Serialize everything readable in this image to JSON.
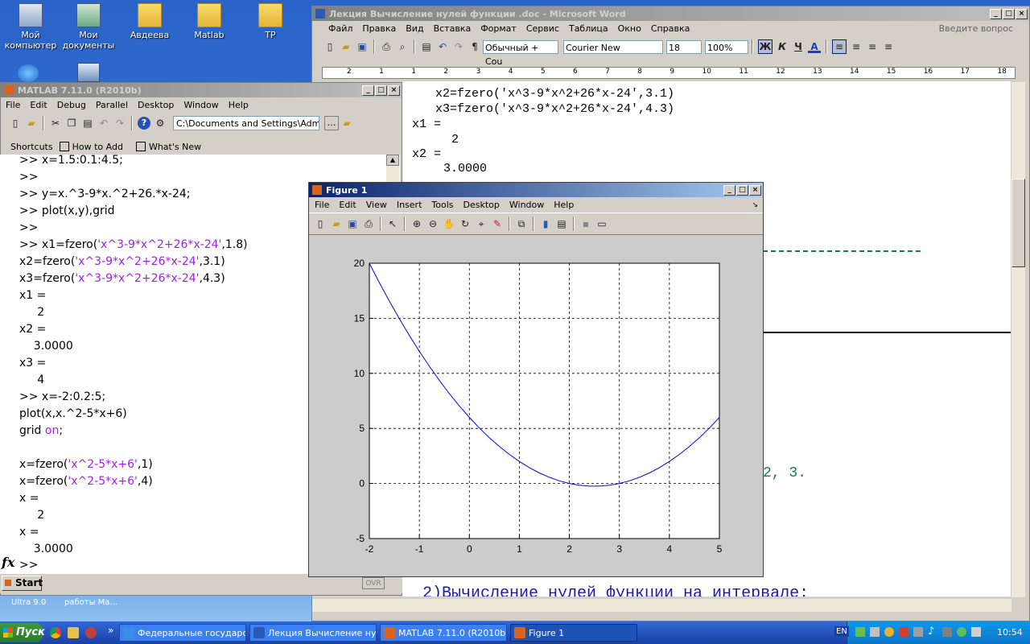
{
  "desktop": {
    "icons": [
      {
        "label": "Мой\nкомпьютер"
      },
      {
        "label": "Мои\nдокументы"
      },
      {
        "label": "Авдеева"
      },
      {
        "label": "Matlab"
      },
      {
        "label": "TP"
      }
    ],
    "behind_text": {
      "line1": "Ultra 9.0",
      "line2": "работы Ма..."
    }
  },
  "matlab": {
    "title": "MATLAB  7.11.0 (R2010b)",
    "menu": [
      "File",
      "Edit",
      "Debug",
      "Parallel",
      "Desktop",
      "Window",
      "Help"
    ],
    "current_folder": "C:\\Documents and Settings\\Admi",
    "shortcuts": {
      "label": "Shortcuts",
      "how_to_add": "How to Add",
      "whats_new": "What's New"
    },
    "fx_symbol": "fx",
    "prompt": ">>",
    "start_button": "Start",
    "ovr": "OVR",
    "command_lines": [
      {
        "plain": ">> x=1.5:0.1:4.5;"
      },
      {
        "plain": ">>"
      },
      {
        "plain": ">> y=x.^3-9*x.^2+26.*x-24;"
      },
      {
        "plain": ">> plot(x,y),grid"
      },
      {
        "plain": ">>"
      },
      {
        "pre": ">> x1=fzero(",
        "str": "'x^3-9*x^2+26*x-24'",
        "post": ",1.8)"
      },
      {
        "pre": "x2=fzero(",
        "str": "'x^3-9*x^2+26*x-24'",
        "post": ",3.1)"
      },
      {
        "pre": "x3=fzero(",
        "str": "'x^3-9*x^2+26*x-24'",
        "post": ",4.3)"
      },
      {
        "plain": "x1 ="
      },
      {
        "plain": "     2"
      },
      {
        "plain": "x2 ="
      },
      {
        "plain": "    3.0000"
      },
      {
        "plain": "x3 ="
      },
      {
        "plain": "     4"
      },
      {
        "plain": ">> x=-2:0.2:5;"
      },
      {
        "plain": "plot(x,x.^2-5*x+6)"
      },
      {
        "pre": "grid ",
        "str": "on",
        "post": ";"
      },
      {
        "plain": ""
      },
      {
        "pre": "x=fzero(",
        "str": "'x^2-5*x+6'",
        "post": ",1)"
      },
      {
        "pre": "x=fzero(",
        "str": "'x^2-5*x+6'",
        "post": ",4)"
      },
      {
        "plain": "x ="
      },
      {
        "plain": "     2"
      },
      {
        "plain": "x ="
      },
      {
        "plain": "    3.0000"
      }
    ]
  },
  "word": {
    "title": "Лекция Вычисление нулей функции .doc - Microsoft Word",
    "menu": [
      "Файл",
      "Правка",
      "Вид",
      "Вставка",
      "Формат",
      "Сервис",
      "Таблица",
      "Окно",
      "Справка"
    ],
    "help_placeholder": "Введите вопрос",
    "style": "Обычный + Cou",
    "font": "Courier New",
    "size": "18",
    "zoom": "100%",
    "bold_btn": "Ж",
    "italic_btn": "К",
    "underline_btn": "Ч",
    "color_btn": "A",
    "ruler_numbers": [
      "2",
      "1",
      "1",
      "2",
      "3",
      "4",
      "5",
      "6",
      "7",
      "8",
      "9",
      "10",
      "11",
      "12",
      "13",
      "14",
      "15",
      "16",
      "17",
      "18"
    ],
    "lines": {
      "l1": "x2=fzero('x^3-9*x^2+26*x-24',3.1)",
      "l2": "x3=fzero('x^3-9*x^2+26*x-24',4.3)",
      "l3": "x1 =",
      "l4": "2",
      "l5": "x2 =",
      "l6": "3.0000",
      "roots_tail": "2, 3.",
      "heading": "2)Вычисление нулей функции на интервале:"
    }
  },
  "figure": {
    "title": "Figure 1",
    "menu": [
      "File",
      "Edit",
      "View",
      "Insert",
      "Tools",
      "Desktop",
      "Window",
      "Help"
    ],
    "chart_data": {
      "type": "line",
      "function": "x.^2-5*x+6",
      "x": [
        -2,
        -1.8,
        -1.6,
        -1.4,
        -1.2,
        -1,
        -0.8,
        -0.6,
        -0.4,
        -0.2,
        0,
        0.2,
        0.4,
        0.6,
        0.8,
        1,
        1.2,
        1.4,
        1.6,
        1.8,
        2,
        2.2,
        2.4,
        2.6,
        2.8,
        3,
        3.2,
        3.4,
        3.6,
        3.8,
        4,
        4.2,
        4.4,
        4.6,
        4.8,
        5
      ],
      "y": [
        20,
        18.24,
        16.56,
        14.96,
        13.44,
        12,
        10.64,
        9.36,
        8.16,
        7.04,
        6,
        5.04,
        4.16,
        3.36,
        2.64,
        2,
        1.44,
        0.96,
        0.56,
        0.24,
        0,
        -0.16,
        -0.24,
        -0.24,
        -0.16,
        0,
        0.24,
        0.56,
        0.96,
        1.44,
        2,
        2.64,
        3.36,
        4.16,
        5.04,
        6
      ],
      "xlim": [
        -2,
        5
      ],
      "ylim": [
        -5,
        20
      ],
      "xticks": [
        "-2",
        "-1",
        "0",
        "1",
        "2",
        "3",
        "4",
        "5"
      ],
      "yticks": [
        "20",
        "15",
        "10",
        "5",
        "0",
        "-5"
      ],
      "grid": true,
      "line_color": "#0000ff"
    }
  },
  "taskbar": {
    "start": "Пуск",
    "tasks": [
      {
        "label": "Федеральные государс..."
      },
      {
        "label": "Лекция Вычисление ну..."
      },
      {
        "label": "MATLAB  7.11.0 (R2010b)"
      },
      {
        "label": "Figure 1"
      }
    ],
    "lang": "EN",
    "clock": "10:54"
  }
}
